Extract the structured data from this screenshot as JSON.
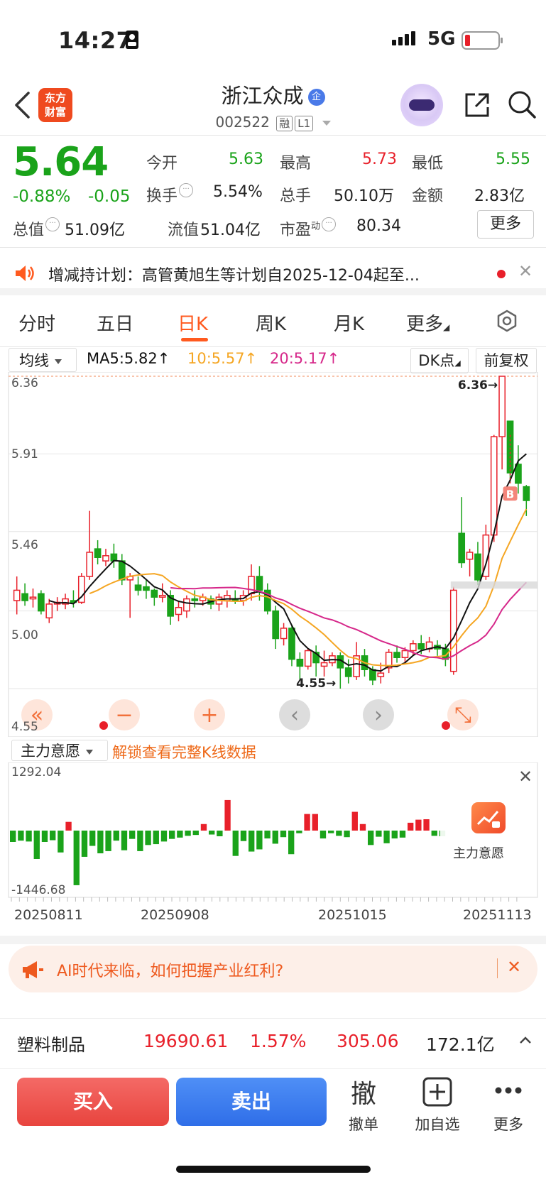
{
  "status": {
    "time": "14:27",
    "network": "5G"
  },
  "header": {
    "logo": [
      "东方",
      "财富"
    ],
    "stock_name": "浙江众成",
    "badge": "企",
    "code": "002522",
    "tag1": "融",
    "tag2": "L1"
  },
  "quote": {
    "price": "5.64",
    "change_pct": "-0.88%",
    "change": "-0.05",
    "open_label": "今开",
    "open": "5.63",
    "high_label": "最高",
    "high": "5.73",
    "low_label": "最低",
    "low": "5.55",
    "turnover_label": "换手",
    "turnover": "5.54%",
    "volume_label": "总手",
    "volume": "50.10万",
    "amount_label": "金额",
    "amount": "2.83亿",
    "mcap_label": "总值",
    "mcap": "51.09亿",
    "float_label": "流值",
    "float": "51.04亿",
    "pe_label": "市盈",
    "pe_sup": "动",
    "pe": "80.34",
    "more_label": "更多"
  },
  "notice": {
    "text": "增减持计划：高管黄旭生等计划自2025-12-04起至..."
  },
  "tabs": [
    "分时",
    "五日",
    "日K",
    "周K",
    "月K",
    "更多"
  ],
  "active_tab": "日K",
  "chart_toolbar": {
    "ma_select": "均线",
    "ma5": "MA5:5.82",
    "ma10": "10:5.57",
    "ma20": "20:5.17",
    "dk": "DK点",
    "adjust": "前复权"
  },
  "colors": {
    "up": "#e8202a",
    "down": "#1aa31a",
    "ma5": "#111111",
    "ma10": "#f5a623",
    "ma20": "#d6288a"
  },
  "chart_data": [
    {
      "type": "candlestick",
      "y_ticks": [
        "6.36",
        "5.91",
        "5.46",
        "5.00",
        "4.55"
      ],
      "ylim": [
        4.55,
        6.36
      ],
      "annotations": [
        "6.36→",
        "4.55→"
      ],
      "marker_label": "B",
      "candles": [
        [
          5.06,
          5.12,
          5.2,
          4.98
        ],
        [
          5.1,
          5.06,
          5.16,
          5.03
        ],
        [
          5.07,
          5.08,
          5.13,
          5.02
        ],
        [
          5.1,
          5.0,
          5.12,
          4.98
        ],
        [
          4.96,
          5.04,
          5.07,
          4.93
        ],
        [
          5.04,
          5.05,
          5.08,
          5.0
        ],
        [
          5.04,
          5.07,
          5.1,
          5.01
        ],
        [
          5.06,
          5.05,
          5.12,
          5.02
        ],
        [
          5.05,
          5.2,
          5.22,
          5.04
        ],
        [
          5.2,
          5.34,
          5.58,
          5.18
        ],
        [
          5.36,
          5.31,
          5.41,
          5.27
        ],
        [
          5.29,
          5.32,
          5.36,
          5.26
        ],
        [
          5.33,
          5.29,
          5.39,
          5.25
        ],
        [
          5.29,
          5.18,
          5.33,
          5.15
        ],
        [
          5.18,
          5.2,
          5.22,
          4.96
        ],
        [
          5.15,
          5.12,
          5.2,
          5.09
        ],
        [
          5.14,
          5.12,
          5.18,
          5.07
        ],
        [
          5.12,
          5.08,
          5.13,
          5.03
        ],
        [
          5.08,
          5.09,
          5.16,
          5.05
        ],
        [
          5.09,
          4.97,
          5.12,
          4.92
        ],
        [
          4.98,
          5.02,
          5.06,
          4.94
        ],
        [
          5.0,
          5.07,
          5.09,
          4.96
        ],
        [
          5.07,
          5.06,
          5.12,
          5.02
        ],
        [
          5.06,
          5.08,
          5.1,
          5.03
        ],
        [
          5.07,
          5.04,
          5.09,
          5.01
        ],
        [
          5.04,
          5.08,
          5.1,
          5.0
        ],
        [
          5.06,
          5.09,
          5.12,
          5.02
        ],
        [
          5.07,
          5.06,
          5.12,
          5.04
        ],
        [
          5.06,
          5.09,
          5.12,
          5.03
        ],
        [
          5.1,
          5.2,
          5.27,
          5.06
        ],
        [
          5.2,
          5.12,
          5.26,
          5.06
        ],
        [
          5.12,
          5.0,
          5.16,
          4.98
        ],
        [
          5.0,
          4.84,
          5.03,
          4.78
        ],
        [
          4.84,
          4.9,
          4.93,
          4.8
        ],
        [
          4.9,
          4.72,
          4.92,
          4.68
        ],
        [
          4.72,
          4.68,
          4.76,
          4.6
        ],
        [
          4.68,
          4.77,
          4.78,
          4.66
        ],
        [
          4.76,
          4.7,
          4.8,
          4.62
        ],
        [
          4.68,
          4.7,
          4.77,
          4.62
        ],
        [
          4.7,
          4.74,
          4.76,
          4.68
        ],
        [
          4.74,
          4.67,
          4.76,
          4.55
        ],
        [
          4.67,
          4.62,
          4.72,
          4.58
        ],
        [
          4.62,
          4.74,
          4.82,
          4.6
        ],
        [
          4.74,
          4.66,
          4.78,
          4.62
        ],
        [
          4.66,
          4.6,
          4.68,
          4.57
        ],
        [
          4.62,
          4.64,
          4.7,
          4.58
        ],
        [
          4.67,
          4.76,
          4.78,
          4.64
        ],
        [
          4.76,
          4.73,
          4.8,
          4.7
        ],
        [
          4.73,
          4.77,
          4.79,
          4.7
        ],
        [
          4.77,
          4.81,
          4.83,
          4.74
        ],
        [
          4.81,
          4.78,
          4.86,
          4.75
        ],
        [
          4.78,
          4.82,
          4.85,
          4.76
        ],
        [
          4.8,
          4.78,
          4.83,
          4.74
        ],
        [
          4.78,
          4.72,
          4.81,
          4.68
        ],
        [
          4.65,
          5.12,
          5.14,
          4.63
        ],
        [
          5.45,
          5.28,
          5.66,
          5.25
        ],
        [
          5.3,
          5.34,
          5.36,
          5.2
        ],
        [
          5.33,
          5.18,
          5.4,
          5.15
        ],
        [
          5.2,
          5.44,
          5.5,
          5.18
        ],
        [
          5.44,
          6.01,
          6.02,
          5.4
        ],
        [
          6.01,
          6.36,
          6.36,
          5.82
        ],
        [
          6.1,
          5.8,
          6.05,
          5.74
        ],
        [
          5.85,
          5.74,
          5.96,
          5.68
        ],
        [
          5.72,
          5.64,
          5.73,
          5.55
        ]
      ]
    },
    {
      "type": "bar",
      "name": "主力意愿",
      "y_ticks": [
        "1292.04",
        "-1446.68"
      ],
      "x_ticks": [
        "20250811",
        "20250908",
        "20251015",
        "20251113"
      ],
      "values": [
        -260,
        -230,
        -250,
        -650,
        -260,
        -220,
        -500,
        200,
        -1250,
        -600,
        -350,
        -520,
        -470,
        -230,
        -450,
        -190,
        -470,
        -330,
        -310,
        -250,
        -190,
        -160,
        -120,
        -100,
        150,
        -90,
        -130,
        700,
        -580,
        -240,
        -480,
        -430,
        -180,
        -300,
        -150,
        -540,
        -60,
        380,
        380,
        -180,
        -60,
        -120,
        -150,
        430,
        150,
        -330,
        -140,
        -290,
        -180,
        -160,
        180,
        250,
        260,
        -120,
        -130
      ]
    }
  ],
  "indicator": {
    "select": "主力意愿",
    "unlock": "解锁查看完整K线数据",
    "card_label": "主力意愿"
  },
  "banner": {
    "text": "AI时代来临，如何把握产业红利?"
  },
  "sector": {
    "name": "塑料制品",
    "value": "19690.61",
    "pct": "1.57%",
    "change": "305.06",
    "amount": "172.1亿"
  },
  "bottom": {
    "buy": "买入",
    "sell": "卖出",
    "cancel_big": "撤",
    "cancel": "撤单",
    "add_fav": "加自选",
    "more": "更多"
  }
}
